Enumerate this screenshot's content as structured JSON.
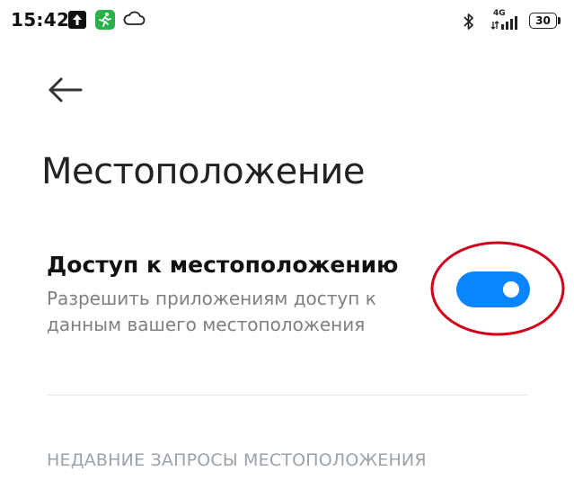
{
  "status_bar": {
    "time": "15:42",
    "network": "4G",
    "battery": "30"
  },
  "page": {
    "title": "Местоположение"
  },
  "location_access": {
    "title": "Доступ к местоположению",
    "description": "Разрешить приложениям доступ к данным вашего местоположения",
    "enabled": true
  },
  "recent_requests": {
    "header": "НЕДАВНИЕ ЗАПРОСЫ МЕСТОПОЛОЖЕНИЯ"
  },
  "colors": {
    "accent": "#0a84ff",
    "highlight": "#d0021b",
    "secondary_text": "#808080",
    "section_text": "#9aa3ab"
  },
  "icons": [
    "upload-icon",
    "fitness-app-icon",
    "cloud-icon",
    "bluetooth-icon",
    "signal-icon",
    "battery-icon",
    "back-arrow-icon"
  ]
}
